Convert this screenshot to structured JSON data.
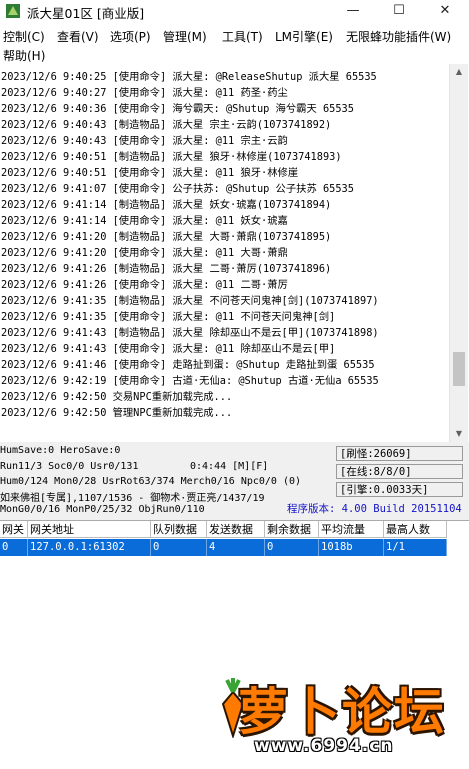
{
  "window": {
    "title": "派大星01区 [商业版]",
    "minimize": "—",
    "maximize": "☐",
    "close": "✕"
  },
  "menu": [
    "控制(C)",
    "查看(V)",
    "选项(P)",
    "管理(M)",
    "工具(T)",
    "LM引擎(E)",
    "无限蜂功能插件(W)",
    "帮助(H)"
  ],
  "log": [
    "2023/12/6 9:40:25 [使用命令] 派大星: @ReleaseShutup 派大星 65535",
    "2023/12/6 9:40:27 [使用命令] 派大星: @11 药圣·药尘",
    "2023/12/6 9:40:36 [使用命令] 海兮霸天: @Shutup 海兮霸天 65535",
    "2023/12/6 9:40:43 [制造物品] 派大星 宗主·云韵(1073741892)",
    "2023/12/6 9:40:43 [使用命令] 派大星: @11 宗主·云韵",
    "2023/12/6 9:40:51 [制造物品] 派大星 狼牙·林修崖(1073741893)",
    "2023/12/6 9:40:51 [使用命令] 派大星: @11 狼牙·林修崖",
    "2023/12/6 9:41:07 [使用命令] 公子扶苏: @Shutup 公子扶苏 65535",
    "2023/12/6 9:41:14 [制造物品] 派大星 妖女·琥嘉(1073741894)",
    "2023/12/6 9:41:14 [使用命令] 派大星: @11 妖女·琥嘉",
    "2023/12/6 9:41:20 [制造物品] 派大星 大哥·萧鼎(1073741895)",
    "2023/12/6 9:41:20 [使用命令] 派大星: @11 大哥·萧鼎",
    "2023/12/6 9:41:26 [制造物品] 派大星 二哥·萧厉(1073741896)",
    "2023/12/6 9:41:26 [使用命令] 派大星: @11 二哥·萧厉",
    "2023/12/6 9:41:35 [制造物品] 派大星 不问苍天问鬼神[剑](1073741897)",
    "2023/12/6 9:41:35 [使用命令] 派大星: @11 不问苍天问鬼神[剑]",
    "2023/12/6 9:41:43 [制造物品] 派大星 除却巫山不是云[甲](1073741898)",
    "2023/12/6 9:41:43 [使用命令] 派大星: @11 除却巫山不是云[甲]",
    "2023/12/6 9:41:46 [使用命令] 走路扯到蛋: @Shutup 走路扯到蛋 65535",
    "2023/12/6 9:42:19 [使用命令] 古道·无仙a: @Shutup 古道·无仙a 65535",
    "2023/12/6 9:42:50 交易NPC重新加载完成...",
    "2023/12/6 9:42:50 管理NPC重新加载完成..."
  ],
  "status": {
    "line1": "HumSave:0 HeroSave:0",
    "line2": "Run11/3 Soc0/0 Usr0/131",
    "time": "0:4:44 [M][F]",
    "line3": "Hum0/124 Mon0/28 UsrRot63/374 Merch0/16 Npc0/0 (0)",
    "line4": "如来佛祖[专属],1107/1536 - 御物术·贾正亮/1437/19",
    "line5": "MonG0/0/16 MonP0/25/32 ObjRun0/110",
    "refresh": "[刷怪:26069]",
    "online": "[在线:8/8/0]",
    "engine": "[引擎:0.0033天]",
    "version": "程序版本: 4.00 Build 20151104"
  },
  "table": {
    "headers": [
      "网关",
      "网关地址",
      "队列数据",
      "发送数据",
      "剩余数据",
      "平均流量",
      "最高人数"
    ],
    "rows": [
      [
        "0",
        "127.0.0.1:61302",
        "0",
        "4",
        "0",
        "1018b",
        "1/1"
      ]
    ]
  },
  "watermark": {
    "brand": "萝卜论坛",
    "url": "www.6994.cn"
  },
  "colors": {
    "selected_row": "#0a6cd8",
    "version_text": "#1515c8",
    "status_bg": "#f0f0f0",
    "logo_orange": "#ff7a00"
  }
}
